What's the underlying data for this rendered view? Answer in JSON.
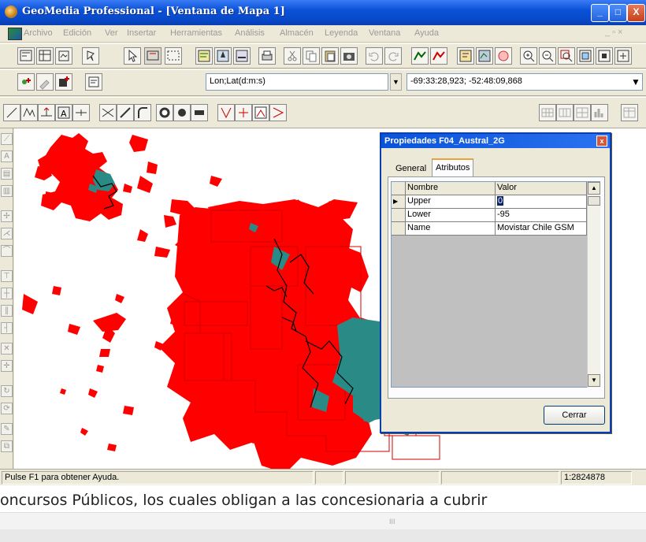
{
  "window": {
    "title": "GeoMedia Professional - [Ventana de Mapa 1]",
    "controls": {
      "minimize": "_",
      "maximize": "□",
      "close": "X"
    }
  },
  "menu": {
    "items": [
      "Archivo",
      "Edición",
      "Ver",
      "Insertar",
      "Herramientas",
      "Análisis",
      "Almacén",
      "Leyenda",
      "Ventana",
      "Ayuda"
    ],
    "mdi_controls": "_ ▫ ×"
  },
  "toolbar2": {
    "coord_format": "Lon;Lat(d:m:s)",
    "coord_value": "-69:33:28,923; -52:48:09,868"
  },
  "dialog": {
    "title": "Propiedades F04_Austral_2G",
    "close_label": "x",
    "tabs": [
      "General",
      "Atributos"
    ],
    "active_tab": "Atributos",
    "columns": [
      "Nombre",
      "Valor"
    ],
    "rows": [
      {
        "name": "Upper",
        "value": "0"
      },
      {
        "name": "Lower",
        "value": "-95"
      },
      {
        "name": "Name",
        "value": "Movistar Chile GSM"
      }
    ],
    "close_button": "Cerrar"
  },
  "status": {
    "help": "Pulse F1 para obtener Ayuda.",
    "scale": "1:2824878"
  },
  "document": {
    "text": "oncursos Públicos, los cuales obligan a las concesionaria a cubrir",
    "scroll_grip": "III"
  },
  "colors": {
    "titlebar": "#0a52d8",
    "coverage_red": "#ff0000",
    "coverage_teal": "#2a8a86",
    "map_background": "#ffffff"
  },
  "icons": {
    "app": "globe-icon",
    "dialog_close": "close-icon"
  }
}
